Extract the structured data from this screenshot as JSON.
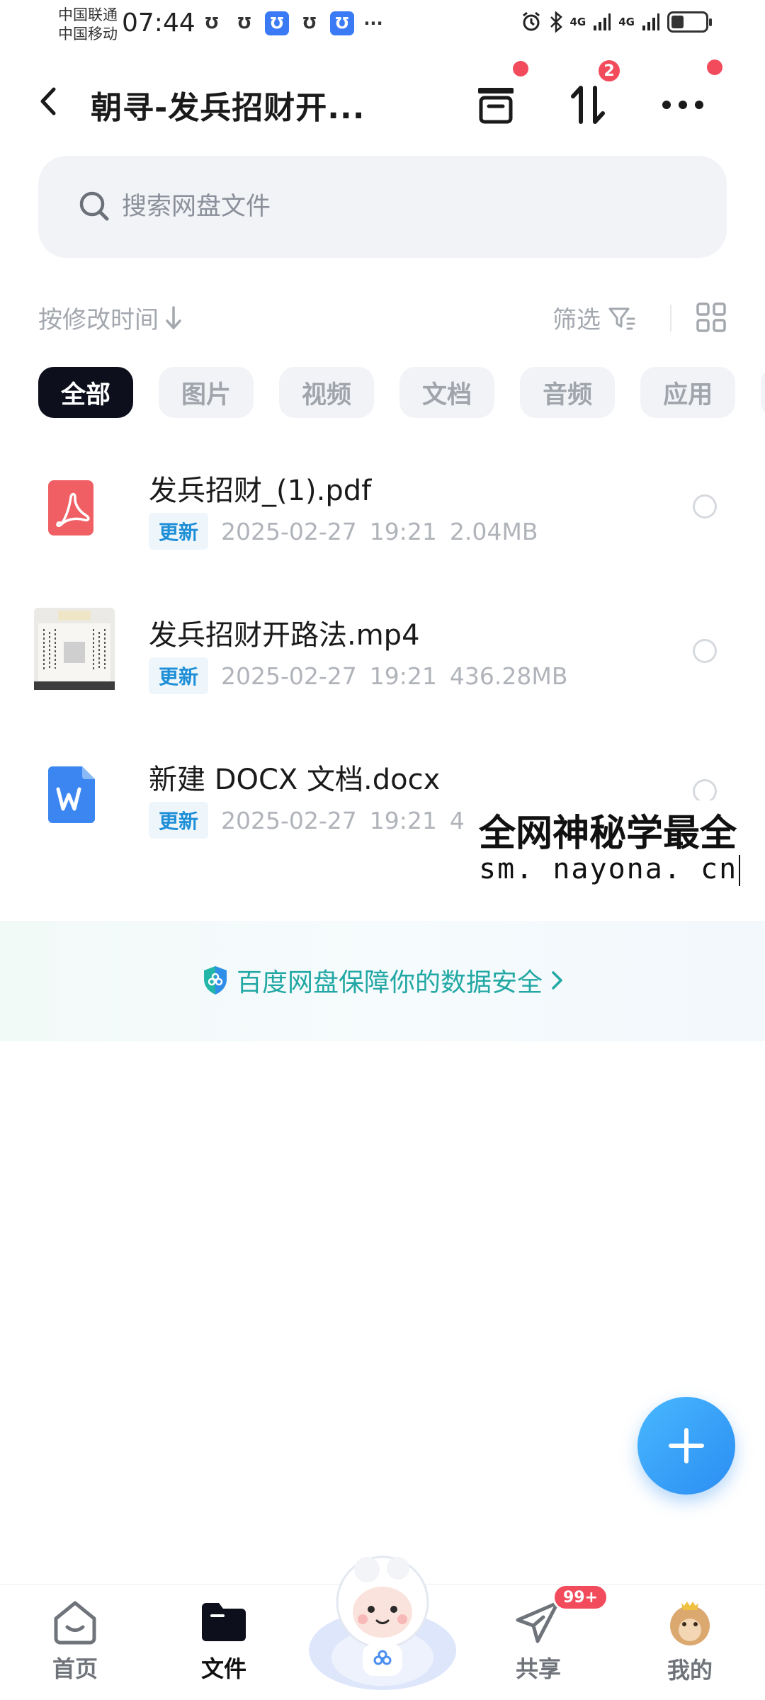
{
  "status_bar": {
    "carrier1": "中国联通",
    "carrier2": "中国移动",
    "time": "07:44",
    "signal1": "4G",
    "signal2": "4G",
    "battery_level": 0.36,
    "notif_icons": [
      "notif-u-icon",
      "notif-u-icon",
      "notif-u-blue-icon",
      "notif-u-icon",
      "notif-u-blue-icon",
      "more-dots-icon"
    ]
  },
  "header": {
    "title": "朝寻-发兵招财开...",
    "transfer_badge": "2"
  },
  "search": {
    "placeholder": "搜索网盘文件"
  },
  "toolbar": {
    "sort_label": "按修改时间",
    "filter_label": "筛选"
  },
  "categories": [
    {
      "label": "全部",
      "active": true
    },
    {
      "label": "图片"
    },
    {
      "label": "视频"
    },
    {
      "label": "文档"
    },
    {
      "label": "音频"
    },
    {
      "label": "应用"
    }
  ],
  "files": [
    {
      "name": "发兵招财_(1).pdf",
      "tag": "更新",
      "date": "2025-02-27",
      "time": "19:21",
      "size": "2.04MB",
      "icon": "pdf-icon"
    },
    {
      "name": "发兵招财开路法.mp4",
      "tag": "更新",
      "date": "2025-02-27",
      "time": "19:21",
      "size": "436.28MB",
      "icon": "video-thumbnail"
    },
    {
      "name": "新建 DOCX 文档.docx",
      "tag": "更新",
      "date": "2025-02-27",
      "time": "19:21",
      "size": "4",
      "icon": "word-icon"
    }
  ],
  "overlay": {
    "line1": "全网神秘学最全",
    "line2": "sm. nayona. cn"
  },
  "security": {
    "label": "百度网盘保障你的数据安全"
  },
  "bottom_nav": {
    "home": "首页",
    "files": "文件",
    "share": "共享",
    "share_badge": "99+",
    "mine": "我的"
  },
  "colors": {
    "accent_blue": "#2b8df2",
    "badge_red": "#f24b5c",
    "security_teal": "#22a8a4",
    "tag_blue": "#1e8fd6",
    "active_chip": "#0d0f1c"
  }
}
